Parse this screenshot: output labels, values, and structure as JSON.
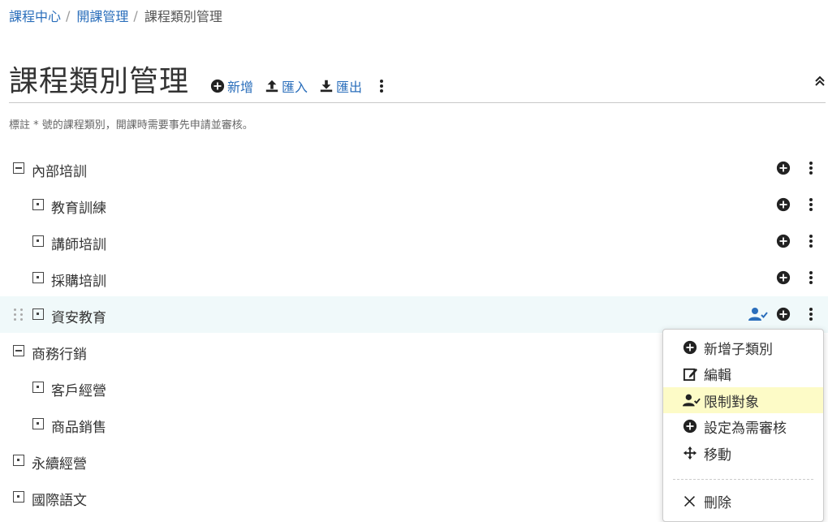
{
  "breadcrumb": {
    "items": [
      "課程中心",
      "開課管理",
      "課程類別管理"
    ],
    "separator": "/"
  },
  "page": {
    "title": "課程類別管理"
  },
  "toolbar": {
    "add_label": "新增",
    "import_label": "匯入",
    "export_label": "匯出"
  },
  "note": "標註 * 號的課程類別，開課時需要事先申請並審核。",
  "tree": {
    "items": [
      {
        "label": "內部培訓",
        "state": "expanded"
      },
      {
        "label": "教育訓練",
        "state": "leaf"
      },
      {
        "label": "講師培訓",
        "state": "leaf"
      },
      {
        "label": "採購培訓",
        "state": "leaf"
      },
      {
        "label": "資安教育",
        "state": "leaf",
        "highlighted": true
      },
      {
        "label": "商務行銷",
        "state": "expanded"
      },
      {
        "label": "客戶經營",
        "state": "leaf"
      },
      {
        "label": "商品銷售",
        "state": "leaf"
      },
      {
        "label": "永續經營",
        "state": "leaf"
      },
      {
        "label": "國際語文",
        "state": "leaf"
      }
    ]
  },
  "context_menu": {
    "items": [
      {
        "label": "新增子類別",
        "icon": "plus-circle-icon"
      },
      {
        "label": "編輯",
        "icon": "edit-icon"
      },
      {
        "label": "限制對象",
        "icon": "user-check-icon",
        "active": true
      },
      {
        "label": "設定為需審核",
        "icon": "plus-circle-icon"
      },
      {
        "label": "移動",
        "icon": "move-icon"
      }
    ],
    "delete_label": "刪除"
  },
  "colors": {
    "link": "#2a6ebb",
    "row_highlight": "#f0f9fa",
    "menu_active": "#fdfbc7",
    "user_check_icon": "#2a6ebb"
  }
}
